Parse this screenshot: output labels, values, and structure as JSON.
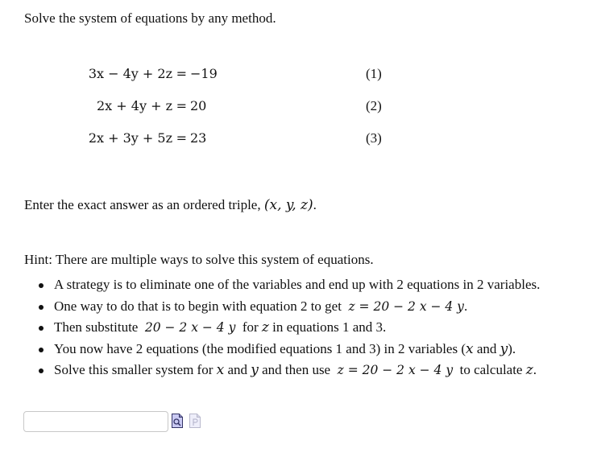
{
  "prompt": "Solve the system of equations by any method.",
  "equations": [
    {
      "lhs": "3x − 4y + 2z",
      "eq": "=",
      "rhs": "−19",
      "label": "(1)"
    },
    {
      "lhs": "2x + 4y + z",
      "eq": "=",
      "rhs": "20",
      "label": "(2)"
    },
    {
      "lhs": "2x + 3y + 5z",
      "eq": "=",
      "rhs": "23",
      "label": "(3)"
    }
  ],
  "instruction": {
    "text": "Enter the exact answer as an ordered triple, ",
    "math": "(x, y, z)",
    "end": "."
  },
  "hint": {
    "title": "Hint: There are multiple ways to solve this system of equations.",
    "items": [
      {
        "parts": [
          "A strategy is to eliminate one of the variables and end up with 2 equations in 2 variables."
        ]
      },
      {
        "before": "One way to do that is to begin with equation 2 to get ",
        "math": "z = 20 − 2 x − 4 y",
        "after": "."
      },
      {
        "before": "Then substitute ",
        "math": "20 − 2 x − 4 y",
        "mid": " for ",
        "math2": "z",
        "after": " in equations 1 and 3."
      },
      {
        "before": "You now have 2 equations (the modified equations 1 and 3) in 2 variables (",
        "math": "x",
        "mid": " and ",
        "math2": "y",
        "after": ")."
      },
      {
        "before": "Solve this smaller system for ",
        "math": "x",
        "mid": " and ",
        "math2": "y",
        "mid2": " and then use ",
        "math3": "z = 20 − 2 x − 4 y",
        "after": " to calculate ",
        "math4": "z",
        "end": "."
      }
    ]
  },
  "answer": {
    "value": "",
    "placeholder": "",
    "preview_icon": "preview-magnifier-icon",
    "format_help_icon": "format-help-page-icon"
  }
}
